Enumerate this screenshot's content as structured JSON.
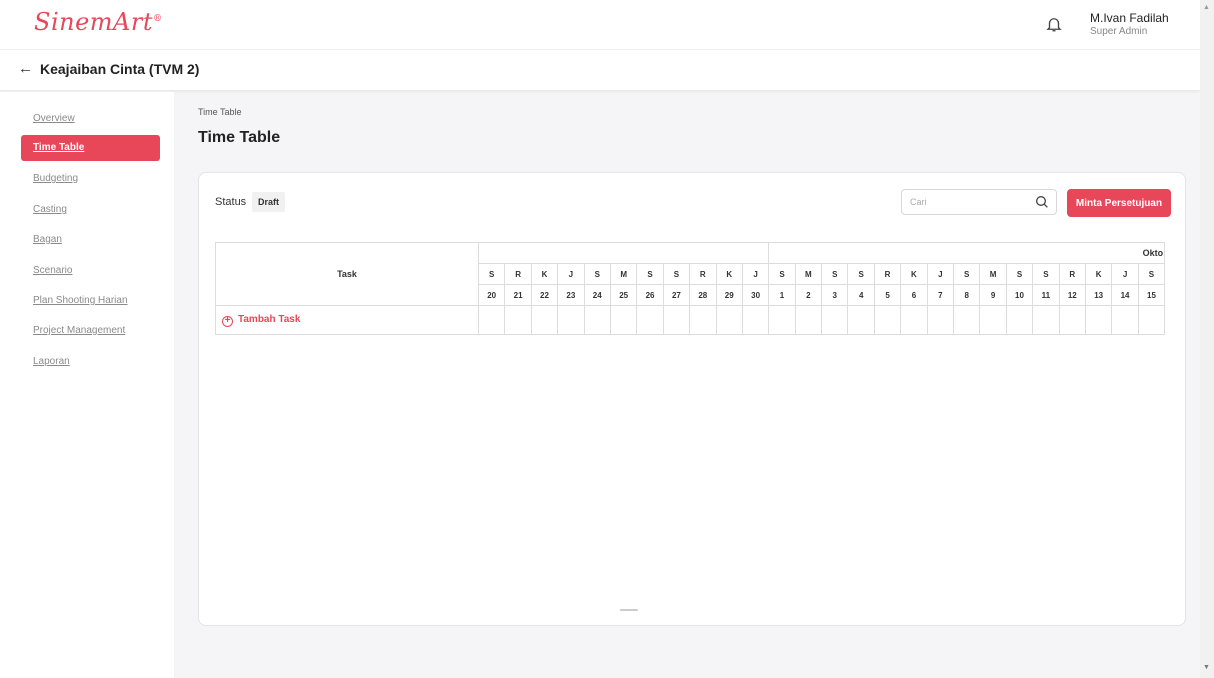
{
  "app": {
    "logo": "SinemArt",
    "logo_mark": "®"
  },
  "header": {
    "user_name": "M.Ivan Fadilah",
    "user_role": "Super Admin",
    "icons": [
      "bell-icon"
    ]
  },
  "subheader": {
    "back_icon": "←",
    "title": "Keajaiban Cinta (TVM 2)"
  },
  "sidebar": {
    "items": [
      {
        "label": "Overview",
        "active": false
      },
      {
        "label": "Time Table",
        "active": true
      },
      {
        "label": "Budgeting",
        "active": false
      },
      {
        "label": "Casting",
        "active": false
      },
      {
        "label": "Bagan",
        "active": false
      },
      {
        "label": "Scenario",
        "active": false
      },
      {
        "label": "Plan Shooting Harian",
        "active": false
      },
      {
        "label": "Project Management",
        "active": false
      },
      {
        "label": "Laporan",
        "active": false
      }
    ]
  },
  "main": {
    "breadcrumb": "Time Table",
    "title": "Time Table",
    "status_label": "Status",
    "status_value": "Draft",
    "search_placeholder": "Cari",
    "approve_button": "Minta Persetujuan",
    "timetable": {
      "task_header": "Task",
      "month_label": "Okto",
      "days": [
        {
          "letter": "S",
          "date": "20"
        },
        {
          "letter": "R",
          "date": "21"
        },
        {
          "letter": "K",
          "date": "22"
        },
        {
          "letter": "J",
          "date": "23"
        },
        {
          "letter": "S",
          "date": "24"
        },
        {
          "letter": "M",
          "date": "25"
        },
        {
          "letter": "S",
          "date": "26"
        },
        {
          "letter": "S",
          "date": "27"
        },
        {
          "letter": "R",
          "date": "28"
        },
        {
          "letter": "K",
          "date": "29"
        },
        {
          "letter": "J",
          "date": "30"
        },
        {
          "letter": "S",
          "date": "1"
        },
        {
          "letter": "M",
          "date": "2"
        },
        {
          "letter": "S",
          "date": "3"
        },
        {
          "letter": "S",
          "date": "4"
        },
        {
          "letter": "R",
          "date": "5"
        },
        {
          "letter": "K",
          "date": "6"
        },
        {
          "letter": "J",
          "date": "7"
        },
        {
          "letter": "S",
          "date": "8"
        },
        {
          "letter": "M",
          "date": "9"
        },
        {
          "letter": "S",
          "date": "10"
        },
        {
          "letter": "S",
          "date": "11"
        },
        {
          "letter": "R",
          "date": "12"
        },
        {
          "letter": "K",
          "date": "13"
        },
        {
          "letter": "J",
          "date": "14"
        },
        {
          "letter": "S",
          "date": "15"
        }
      ],
      "add_task_label": "Tambah Task"
    }
  },
  "colors": {
    "accent": "#e8475a",
    "background": "#f5f5f7"
  }
}
